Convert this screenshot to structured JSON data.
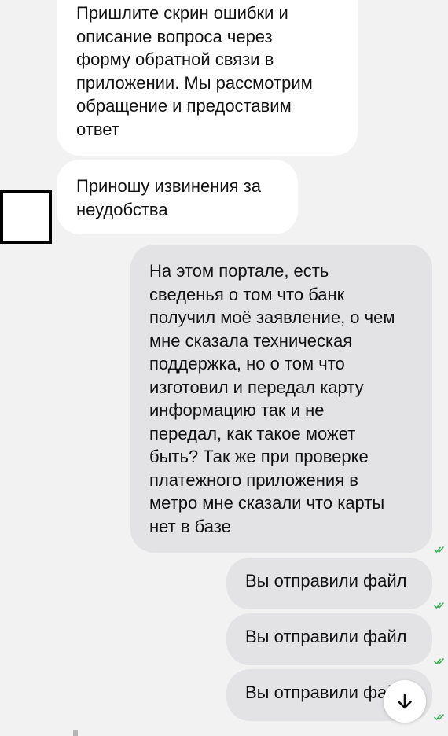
{
  "messages": [
    {
      "direction": "incoming",
      "text": "Пришлите скрин ошибки и\nописание вопроса через\nформу обратной связи в\nприложении. Мы рассмотрим\nобращение и предоставим\nответ"
    },
    {
      "direction": "incoming",
      "text": "Приношу извинения за\nнеудобства"
    },
    {
      "direction": "outgoing",
      "text": "На этом портале, есть\nсведенья о том что банк\nполучил моё заявление, о чем\nмне сказала техническая\nподдержка, но о том что\nизготовил и передал карту\nинформацию так и не\nпередал, как такое может\nбыть? Так же при проверке\nплатежного приложения в\nметро мне сказали что карты\nнет в базе",
      "status": "read"
    },
    {
      "direction": "outgoing",
      "text": "Вы отправили файл",
      "status": "read"
    },
    {
      "direction": "outgoing",
      "text": "Вы отправили файл",
      "status": "read"
    },
    {
      "direction": "outgoing",
      "text": "Вы отправили файл",
      "status": "read"
    }
  ],
  "icons": {
    "read_receipt": "double-check-icon",
    "scroll_down": "arrow-down-icon"
  },
  "colors": {
    "background": "#f2f2f2",
    "incoming_bubble": "#ffffff",
    "outgoing_bubble": "#e3e3e5",
    "read_tick": "#3fae5a"
  }
}
